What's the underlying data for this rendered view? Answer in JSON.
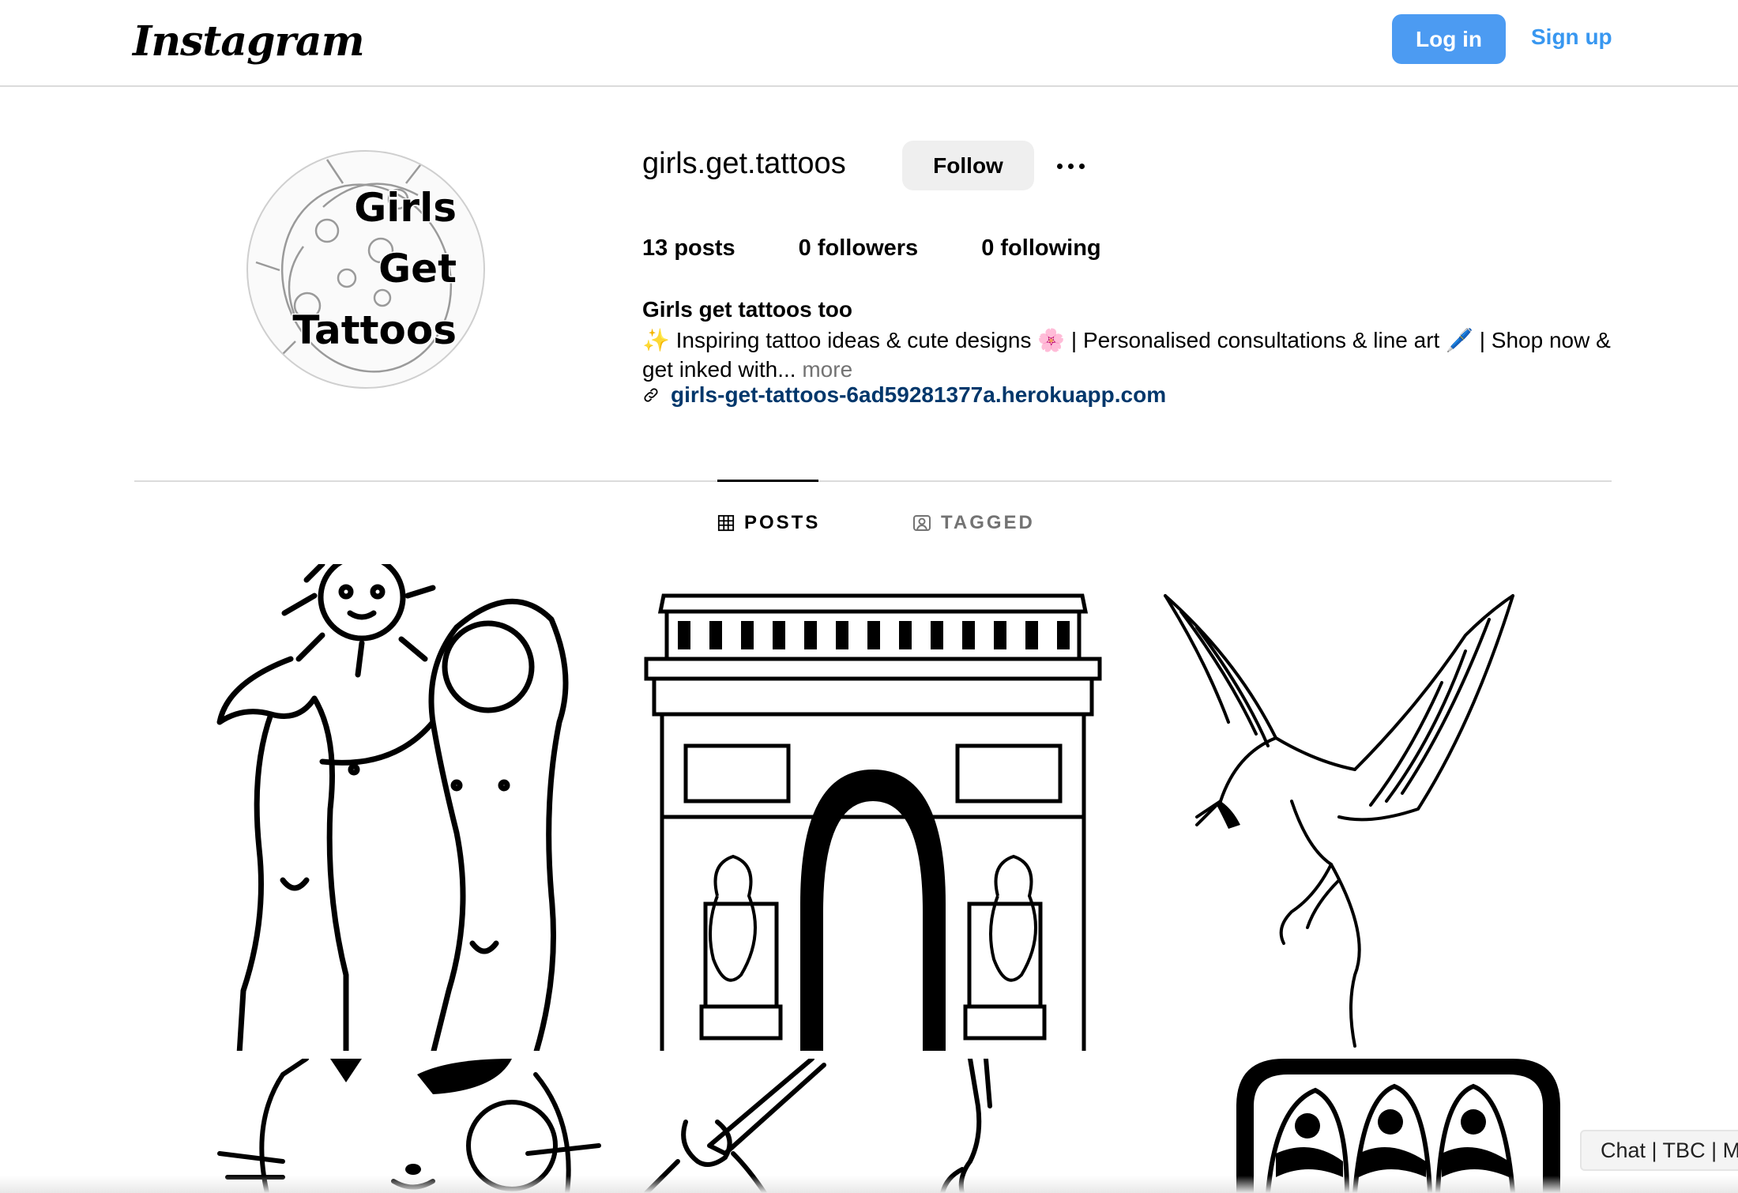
{
  "header": {
    "logo_text": "Instagram",
    "login_label": "Log in",
    "signup_label": "Sign up",
    "accent_color": "#4c9bf2"
  },
  "profile": {
    "username": "girls.get.tattoos",
    "follow_label": "Follow",
    "avatar_text": [
      "Girls",
      "Get",
      "Tattoos"
    ],
    "stats": {
      "posts_count": "13",
      "posts_label": "posts",
      "followers_count": "0",
      "followers_label": "followers",
      "following_count": "0",
      "following_label": "following"
    },
    "bio_name": "Girls get tattoos too",
    "bio_text": "✨ Inspiring tattoo ideas & cute designs 🌸 | Personalised consultations & line art 🖊️ | Shop now & get inked with...",
    "bio_more": "more",
    "link": "girls-get-tattoos-6ad59281377a.herokuapp.com"
  },
  "tabs": [
    {
      "label": "POSTS",
      "icon": "grid-icon",
      "active": true
    },
    {
      "label": "TAGGED",
      "icon": "tagged-icon",
      "active": false
    }
  ],
  "posts": [
    {
      "subject": "sun and moon figures line art"
    },
    {
      "subject": "arc de triomphe line art"
    },
    {
      "subject": "crane in flight line art"
    },
    {
      "subject": "lucky cat line art"
    },
    {
      "subject": "hands holding stick line art"
    },
    {
      "subject": "sardine tin line art"
    }
  ],
  "chat_widget": {
    "label": "Chat | TBC | M"
  }
}
